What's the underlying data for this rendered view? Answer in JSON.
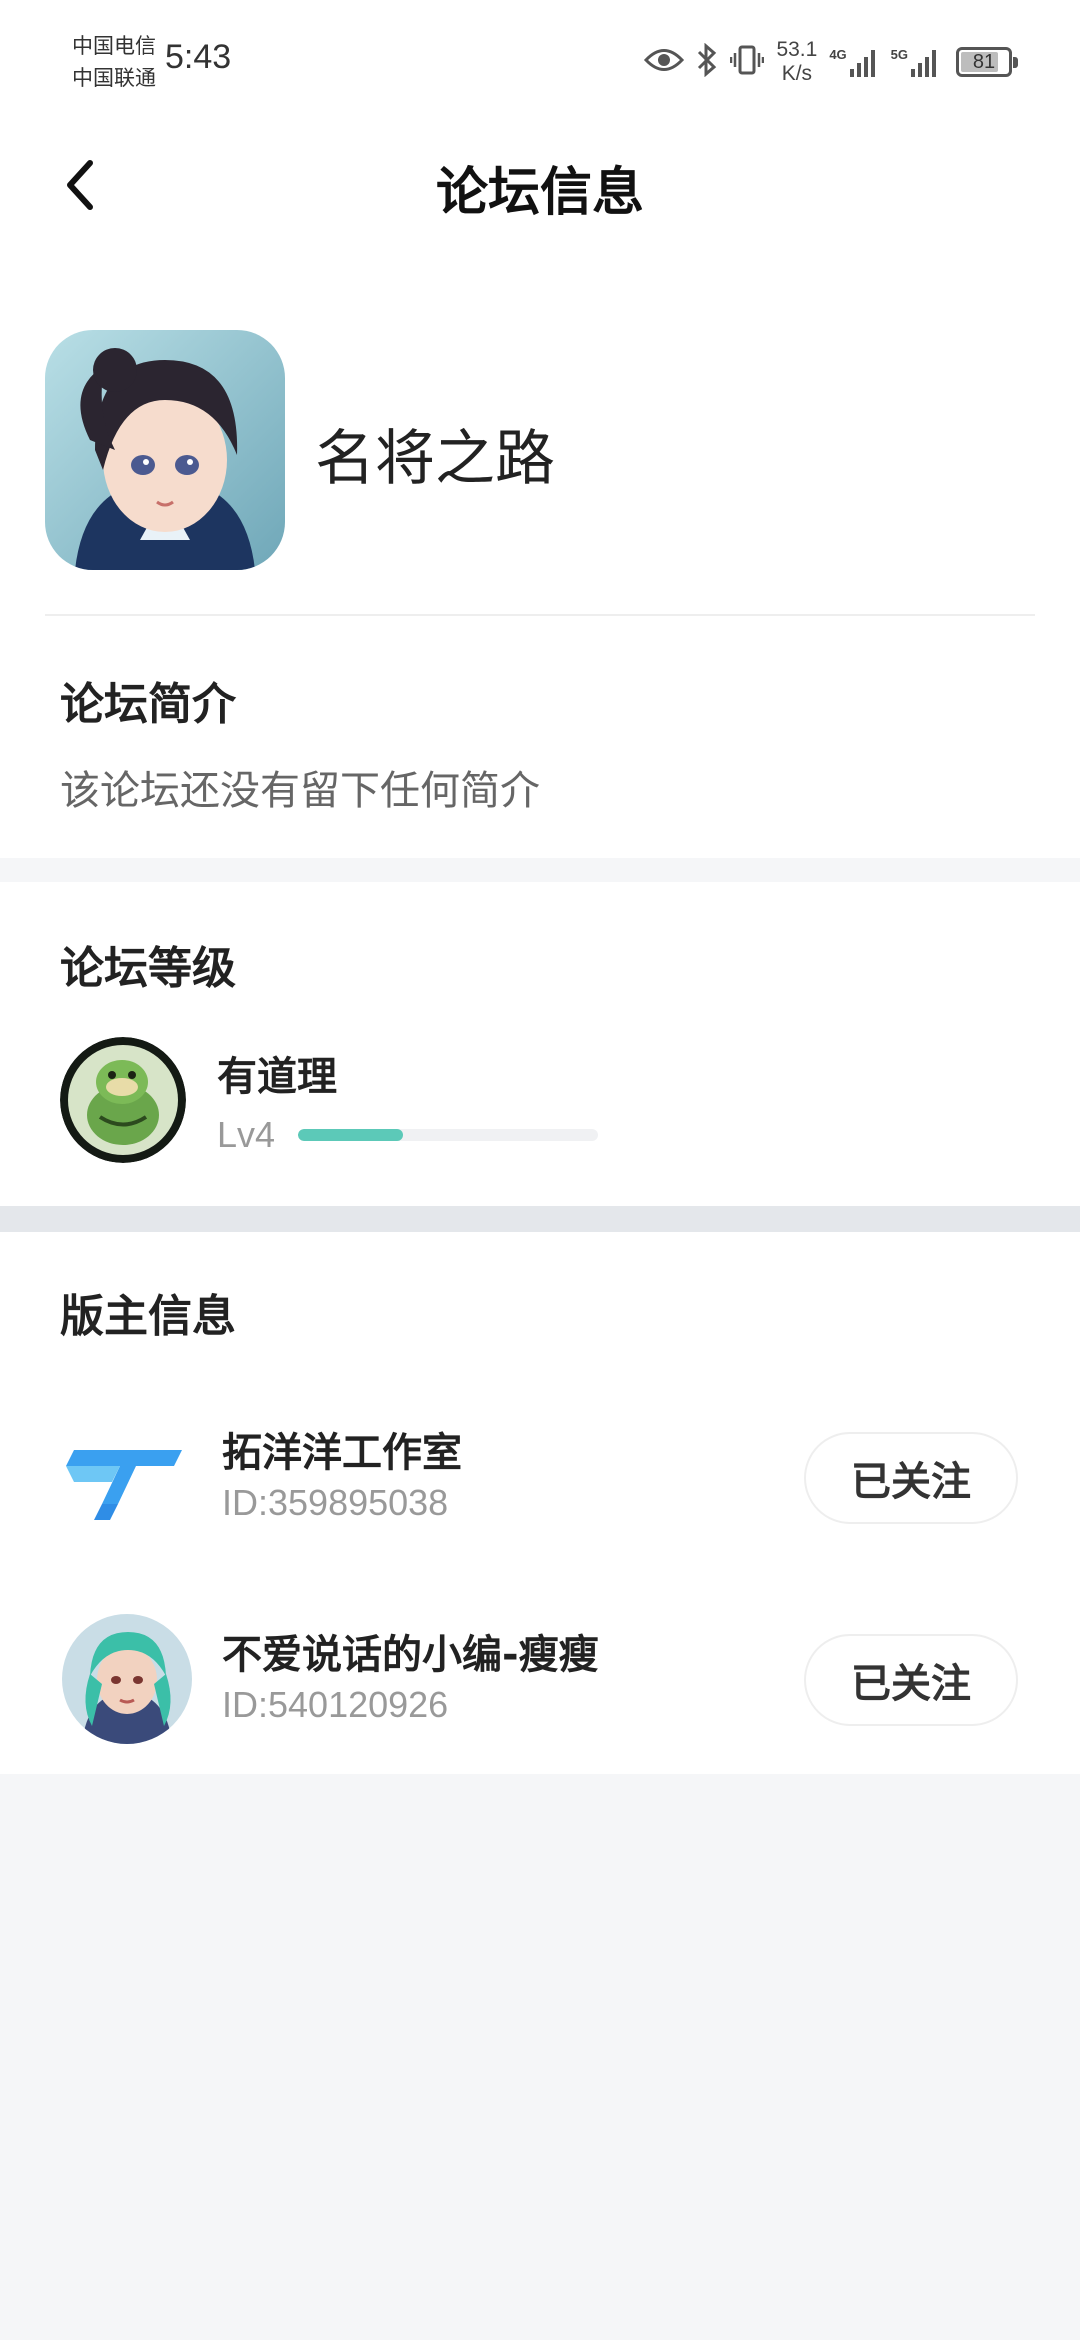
{
  "status_bar": {
    "carrier_1": "中国电信",
    "carrier_2": "中国联通",
    "time": "5:43",
    "speed_value": "53.1",
    "speed_unit": "K/s",
    "network_1": "4G",
    "network_2": "5G",
    "battery": "81",
    "battery_level": 0.81
  },
  "header": {
    "back_icon": "chevron-left-icon",
    "title": "论坛信息"
  },
  "forum": {
    "name": "名将之路",
    "intro_title": "论坛简介",
    "intro_text": "该论坛还没有留下任何简介"
  },
  "level": {
    "section_title": "论坛等级",
    "name": "有道理",
    "level_label": "Lv4",
    "progress": 0.35,
    "accent_color": "#5cc9b8"
  },
  "moderators": {
    "section_title": "版主信息",
    "items": [
      {
        "name": "拓洋洋工作室",
        "id": "ID:359895038",
        "follow_label": "已关注"
      },
      {
        "name": "不爱说话的小编-瘦瘦",
        "id": "ID:540120926",
        "follow_label": "已关注"
      }
    ]
  }
}
